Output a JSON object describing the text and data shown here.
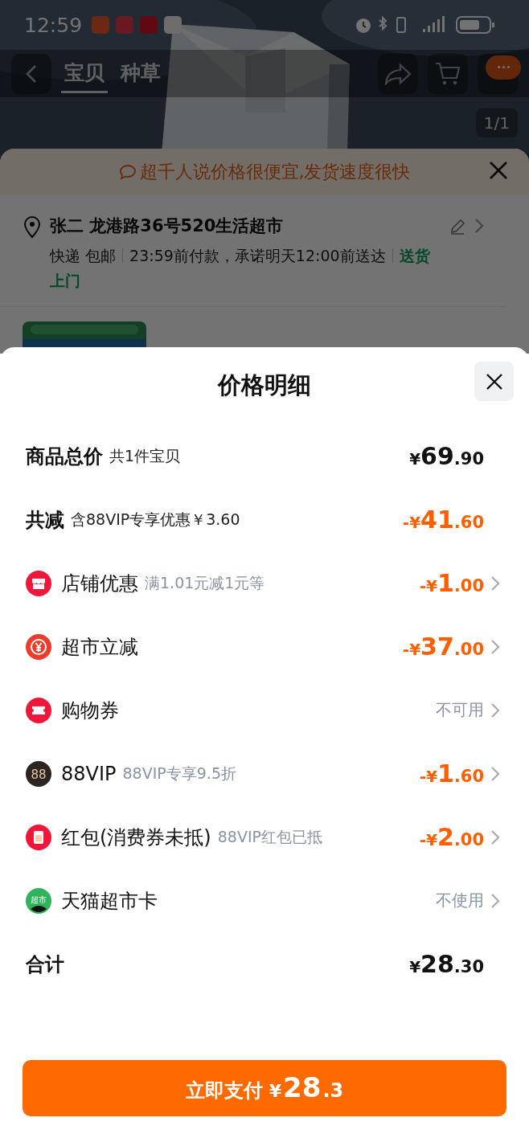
{
  "status_bar": {
    "time": "12:59"
  },
  "nav": {
    "tabs": [
      {
        "label": "宝贝",
        "selected": true
      },
      {
        "label": "种草",
        "selected": false
      }
    ]
  },
  "gallery": {
    "counter": "1/1"
  },
  "order_sheet": {
    "banner": "超千人说价格很便宜,发货速度很快",
    "address": "张二 龙港路36号520生活超市",
    "delivery": [
      "快递 包邮",
      "23:59前付款，承诺明天12:00前送达"
    ],
    "delivery_tag": "送货上门"
  },
  "price_sheet": {
    "title": "价格明细",
    "rows": [
      {
        "kind": "summary",
        "label": "商品总价",
        "note": "共1件宝贝",
        "value": {
          "sign": "¥",
          "int": "69",
          "dec": ".90"
        },
        "discount": false,
        "arrow": false
      },
      {
        "kind": "summary",
        "label": "共减",
        "note": "含88VIP专享优惠￥3.60",
        "value": {
          "sign": "-¥",
          "int": "41",
          "dec": ".60"
        },
        "discount": true,
        "arrow": false
      },
      {
        "kind": "shop",
        "label": "店铺优惠",
        "note": "满1.01元减1元等",
        "value": {
          "sign": "-¥",
          "int": "1",
          "dec": ".00"
        },
        "discount": true,
        "arrow": true
      },
      {
        "kind": "yen",
        "label": "超市立减",
        "value": {
          "sign": "-¥",
          "int": "37",
          "dec": ".00"
        },
        "discount": true,
        "arrow": true
      },
      {
        "kind": "ticket",
        "label": "购物券",
        "status": "不可用",
        "arrow": true
      },
      {
        "kind": "vip",
        "icon_text": "88",
        "label": "88VIP",
        "note": "88VIP专享9.5折",
        "value": {
          "sign": "-¥",
          "int": "1",
          "dec": ".60"
        },
        "discount": true,
        "arrow": true
      },
      {
        "kind": "redpacket",
        "label": "红包(消费券未抵)",
        "note": "88VIP红包已抵",
        "value": {
          "sign": "-¥",
          "int": "2",
          "dec": ".00"
        },
        "discount": true,
        "arrow": true
      },
      {
        "kind": "card",
        "icon_text": "超市",
        "label": "天猫超市卡",
        "status": "不使用",
        "arrow": true
      },
      {
        "kind": "summary",
        "label": "合计",
        "value": {
          "sign": "¥",
          "int": "28",
          "dec": ".30"
        },
        "discount": false,
        "arrow": false
      }
    ],
    "pay_button": {
      "label": "立即支付",
      "sign": "¥",
      "int": "28",
      "dec": ".3"
    }
  }
}
